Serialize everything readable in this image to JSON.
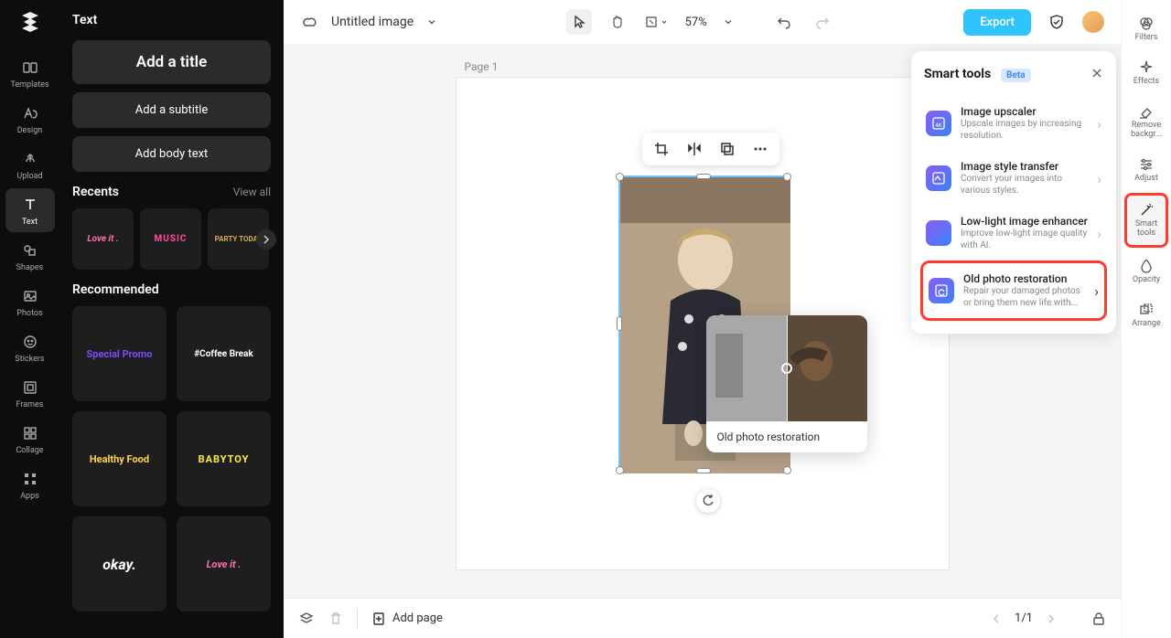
{
  "left_rail": {
    "items": [
      {
        "label": "Templates"
      },
      {
        "label": "Design"
      },
      {
        "label": "Upload"
      },
      {
        "label": "Text"
      },
      {
        "label": "Shapes"
      },
      {
        "label": "Photos"
      },
      {
        "label": "Stickers"
      },
      {
        "label": "Frames"
      },
      {
        "label": "Collage"
      },
      {
        "label": "Apps"
      }
    ]
  },
  "text_panel": {
    "title": "Text",
    "add_title": "Add a title",
    "add_subtitle": "Add a subtitle",
    "add_body": "Add body text",
    "recents_label": "Recents",
    "view_all": "View all",
    "recents": [
      "Love it .",
      "MUSIC",
      "PARTY TODAY"
    ],
    "recommended_label": "Recommended",
    "recommended": [
      "Special Promo",
      "#Coffee Break",
      "Healthy Food",
      "BABYTOY",
      "okay.",
      "Love it ."
    ]
  },
  "topbar": {
    "doc_title": "Untitled image",
    "zoom": "57%",
    "export": "Export"
  },
  "canvas": {
    "page_label": "Page 1",
    "preview_label": "Old photo restoration"
  },
  "smart_panel": {
    "title": "Smart tools",
    "badge": "Beta",
    "items": [
      {
        "name": "Image upscaler",
        "desc": "Upscale images by increasing resolution."
      },
      {
        "name": "Image style transfer",
        "desc": "Convert your images into various styles."
      },
      {
        "name": "Low-light image enhancer",
        "desc": "Improve low-light image quality with AI."
      },
      {
        "name": "Old photo restoration",
        "desc": "Repair your damaged photos or bring them new life with..."
      }
    ]
  },
  "right_rail": {
    "items": [
      {
        "label": "Filters"
      },
      {
        "label": "Effects"
      },
      {
        "label": "Remove backgr..."
      },
      {
        "label": "Adjust"
      },
      {
        "label": "Smart tools"
      },
      {
        "label": "Opacity"
      },
      {
        "label": "Arrange"
      }
    ]
  },
  "bottombar": {
    "add_page": "Add page",
    "page_indicator": "1/1"
  },
  "rec_styles": [
    {
      "color": "#7c4dff"
    },
    {
      "color": "#fff"
    },
    {
      "color": "#ffd54f"
    },
    {
      "color": "#ffeb3b"
    },
    {
      "color": "#fff"
    },
    {
      "color": "#ff6fae"
    }
  ]
}
